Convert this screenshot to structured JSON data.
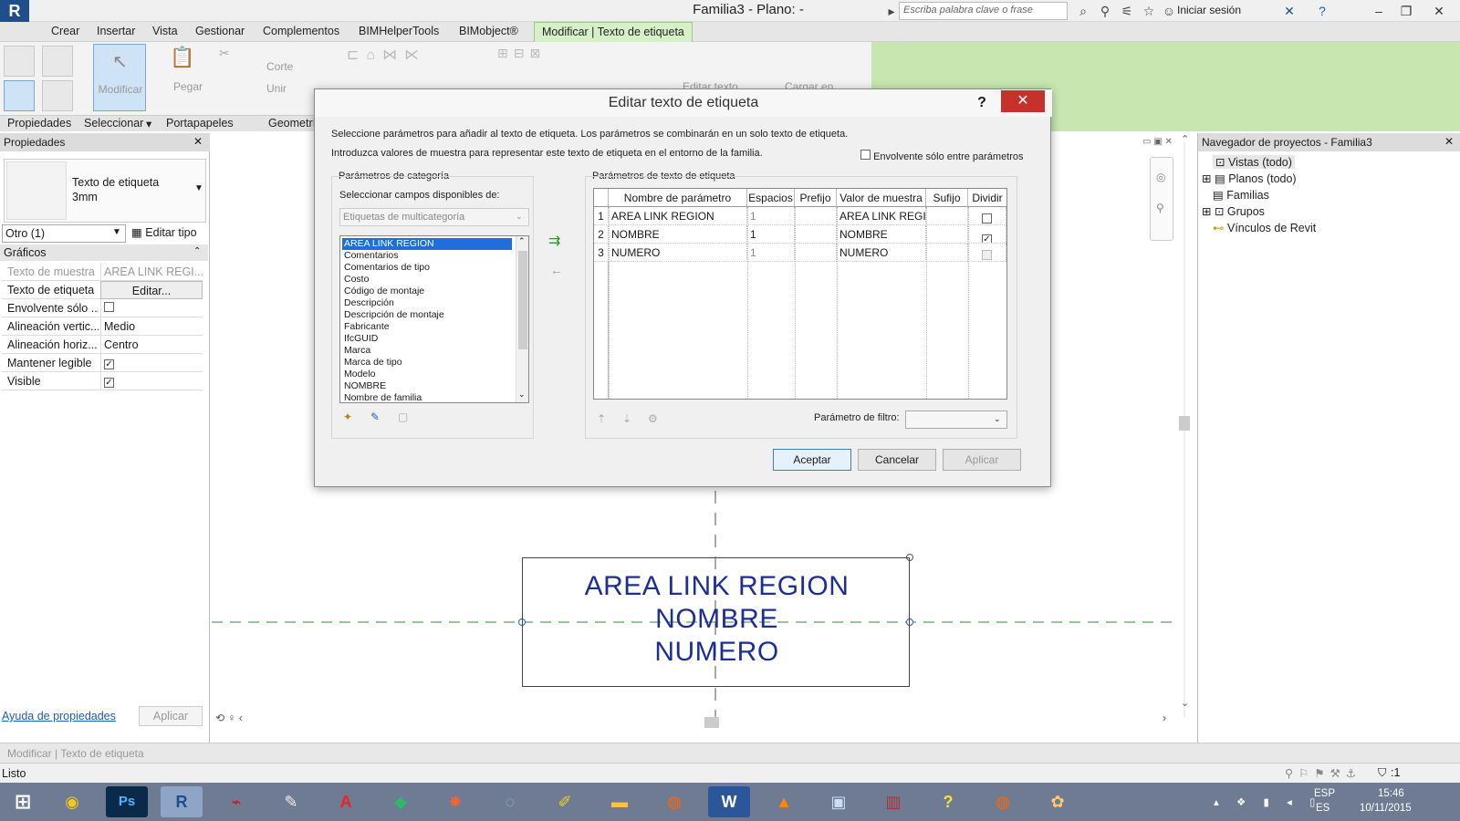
{
  "window": {
    "title": "Familia3 - Plano: -",
    "search_placeholder": "Escriba palabra clave o frase",
    "signin": "Iniciar sesión"
  },
  "menu": {
    "tabs": [
      "Crear",
      "Insertar",
      "Vista",
      "Gestionar",
      "Complementos",
      "BIMHelperTools",
      "BIMobject®"
    ],
    "active_tab": "Modificar | Texto de etiqueta"
  },
  "ribbon": {
    "modify_label": "Modificar",
    "paste_label": "Pegar",
    "cut_label": "Corte",
    "join_label": "Unir",
    "edit_text_label": "Editar texto",
    "load_label": "Cargar en",
    "panels": [
      "Propiedades",
      "Seleccionar",
      "Portapapeles",
      "Geometría"
    ]
  },
  "properties": {
    "header": "Propiedades",
    "type_name": "Texto de etiqueta",
    "type_size": "3mm",
    "instance_selector": "Otro (1)",
    "edit_type": "Editar tipo",
    "group": "Gráficos",
    "rows": [
      {
        "name": "Texto de muestra",
        "value": "AREA LINK REGI..."
      },
      {
        "name": "Texto de etiqueta",
        "value": "Editar..."
      },
      {
        "name": "Envolvente sólo ...",
        "value": ""
      },
      {
        "name": "Alineación vertic...",
        "value": "Medio"
      },
      {
        "name": "Alineación horiz...",
        "value": "Centro"
      },
      {
        "name": "Mantener legible",
        "value": "✓"
      },
      {
        "name": "Visible",
        "value": "✓"
      }
    ],
    "help_link": "Ayuda de propiedades",
    "apply": "Aplicar"
  },
  "canvas": {
    "tag_lines": [
      "AREA LINK REGION",
      "NOMBRE",
      "NUMERO"
    ]
  },
  "browser": {
    "header": "Navegador de proyectos - Familia3",
    "items": [
      "Vistas (todo)",
      "Planos (todo)",
      "Familias",
      "Grupos",
      "Vínculos de Revit"
    ]
  },
  "status": {
    "context": "Modificar | Texto de etiqueta",
    "ready": "Listo",
    "filter_count": ":1"
  },
  "taskbar": {
    "lang": "ESP",
    "region": "ES",
    "time": "15:46",
    "date": "10/11/2015"
  },
  "dialog": {
    "title": "Editar texto de etiqueta",
    "intro1": "Seleccione parámetros para añadir al texto de etiqueta. Los parámetros se combinarán en un solo texto de etiqueta.",
    "intro2": "Introduzca valores de muestra para representar este texto de etiqueta en el entorno de la familia.",
    "wrap_label": "Envolvente sólo entre parámetros",
    "category_group": "Parámetros de categoría",
    "select_fields": "Seleccionar campos disponibles de:",
    "category_select": "Etiquetas de multicategoría",
    "category_items": [
      "AREA LINK REGION",
      "Comentarios",
      "Comentarios de tipo",
      "Costo",
      "Código de montaje",
      "Descripción",
      "Descripción de montaje",
      "Fabricante",
      "IfcGUID",
      "Marca",
      "Marca de tipo",
      "Modelo",
      "NOMBRE",
      "Nombre de familia"
    ],
    "tag_group": "Parámetros de texto de etiqueta",
    "columns": [
      "Nombre de parámetro",
      "Espacios",
      "Prefijo",
      "Valor de muestra",
      "Sufijo",
      "Dividir"
    ],
    "rows": [
      {
        "n": "1",
        "name": "AREA LINK REGION",
        "spaces": "1",
        "prefix": "",
        "sample": "AREA LINK REGI",
        "suffix": "",
        "split": ""
      },
      {
        "n": "2",
        "name": "NOMBRE",
        "spaces": "1",
        "prefix": "",
        "sample": "NOMBRE",
        "suffix": "",
        "split": "✓"
      },
      {
        "n": "3",
        "name": "NUMERO",
        "spaces": "1",
        "prefix": "",
        "sample": "NUMERO",
        "suffix": "",
        "split": ""
      }
    ],
    "filter_label": "Parámetro de filtro:",
    "ok": "Aceptar",
    "cancel": "Cancelar",
    "apply": "Aplicar"
  }
}
